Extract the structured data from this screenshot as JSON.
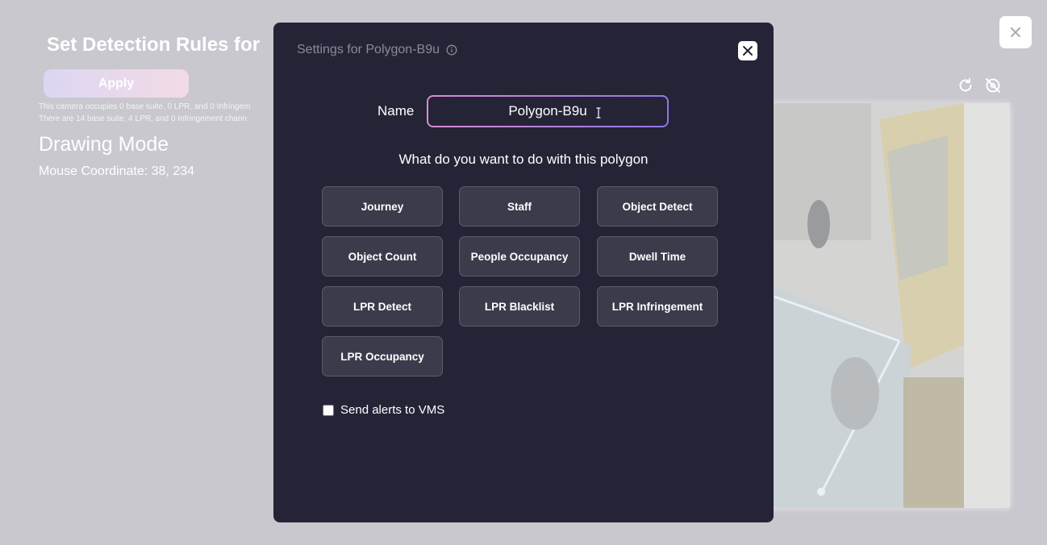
{
  "background": {
    "title": "Set Detection Rules for",
    "apply_label": "Apply",
    "info_line_1": "This camera occupies 0 base suite, 0 LPR, and 0 Infringem",
    "info_line_2": "There are 14 base suite, 4 LPR, and 0 Infringement chann",
    "drawing_mode": "Drawing Mode",
    "mouse_coordinate": "Mouse Coordinate: 38, 234"
  },
  "modal": {
    "title": "Settings for Polygon-B9u",
    "name_label": "Name",
    "name_value": "Polygon-B9u",
    "question": "What do you want to do with this polygon",
    "options": [
      "Journey",
      "Staff",
      "Object Detect",
      "Object Count",
      "People Occupancy",
      "Dwell Time",
      "LPR Detect",
      "LPR Blacklist",
      "LPR Infringement",
      "LPR Occupancy"
    ],
    "send_alerts_label": "Send alerts to VMS",
    "send_alerts_checked": false
  },
  "icons": {
    "top_close": "close-icon",
    "refresh": "refresh-icon",
    "hide": "eye-off-icon",
    "info": "info-icon",
    "modal_close": "close-icon"
  },
  "colors": {
    "modal_bg": "#252437",
    "button_bg": "#3a3c4b",
    "input_gradient_start": "#d88bd3",
    "input_gradient_end": "#8e78e6"
  }
}
